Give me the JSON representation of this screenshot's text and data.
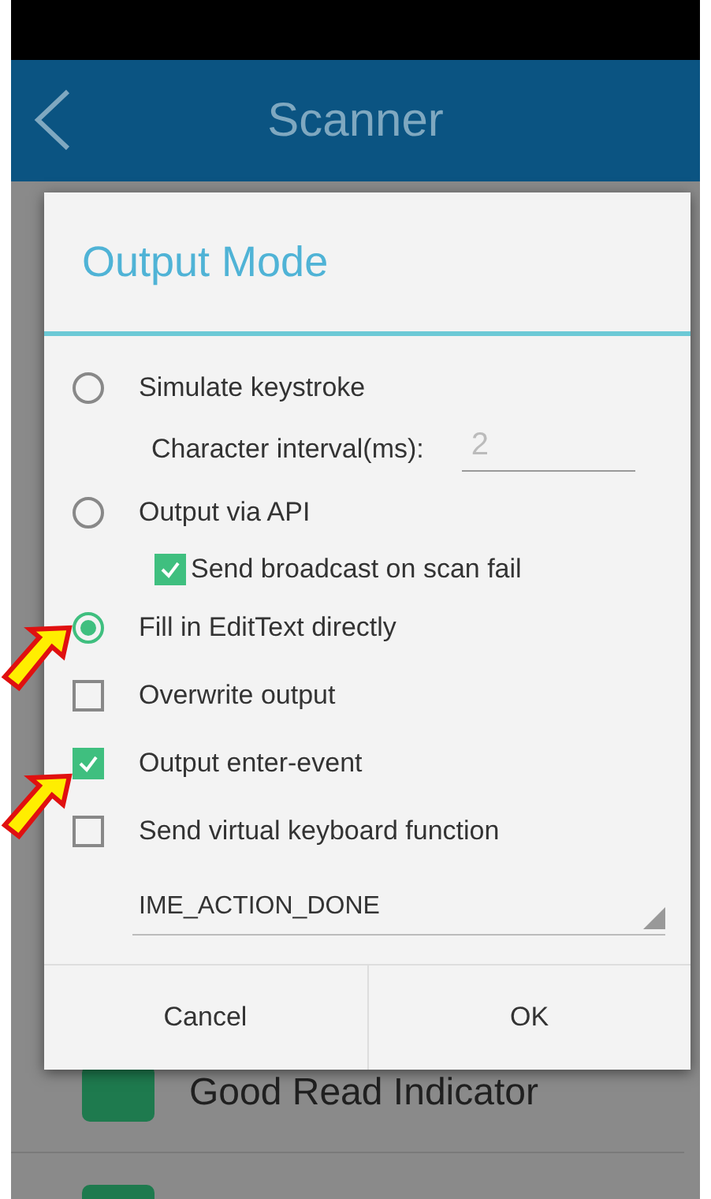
{
  "app_bar": {
    "title": "Scanner"
  },
  "background_list": [
    {
      "label": "Good Read Indicator"
    }
  ],
  "dialog": {
    "title": "Output Mode",
    "items": [
      {
        "kind": "radio",
        "label": "Simulate keystroke",
        "selected": false
      },
      {
        "kind": "field",
        "label": "Character interval(ms):",
        "value": "2"
      },
      {
        "kind": "radio",
        "label": "Output via API",
        "selected": false
      },
      {
        "kind": "subcheck",
        "label": "Send broadcast on scan fail",
        "checked": true
      },
      {
        "kind": "radio",
        "label": "Fill in EditText directly",
        "selected": true
      },
      {
        "kind": "checkbox",
        "label": "Overwrite output",
        "checked": false
      },
      {
        "kind": "checkbox",
        "label": "Output enter-event",
        "checked": true
      },
      {
        "kind": "checkbox",
        "label": "Send virtual keyboard function",
        "checked": false
      },
      {
        "kind": "dropdown",
        "value": "IME_ACTION_DONE"
      }
    ],
    "buttons": [
      "Cancel",
      "OK"
    ]
  }
}
